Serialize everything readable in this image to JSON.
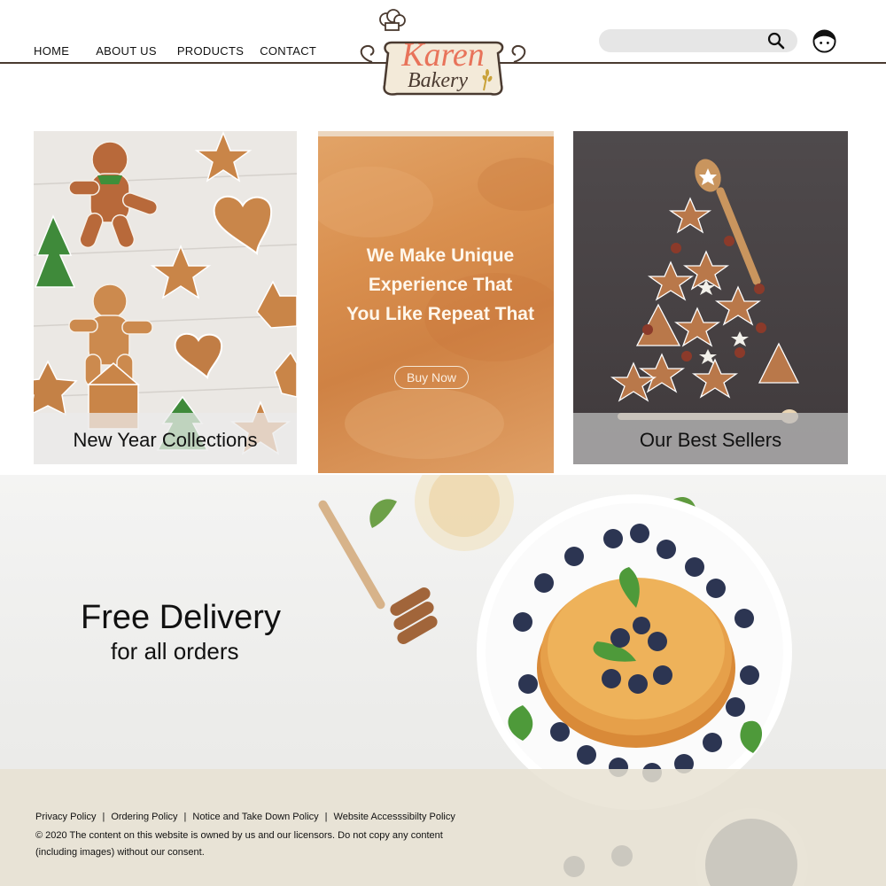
{
  "nav": {
    "home": "HOME",
    "about": "ABOUT US",
    "products": "PRODUCTS",
    "contact": "CONTACT"
  },
  "logo": {
    "line1": "Karen",
    "line2": "Bakery"
  },
  "search": {
    "placeholder": ""
  },
  "cards": {
    "left_caption": "New Year Collections",
    "center_promo": "We Make Unique Experience That You Like Repeat That",
    "center_line1": "We Make Unique",
    "center_line2": "Experience That",
    "center_line3": "You Like Repeat That",
    "center_button": "Buy Now",
    "right_caption": "Our Best Sellers"
  },
  "hero": {
    "title": "Free Delivery",
    "subtitle": "for all orders"
  },
  "footer": {
    "links": [
      "Privacy  Policy",
      "Ordering Policy",
      "Notice and Take Down Policy",
      "Website Accesssibilty  Policy"
    ],
    "copyright_line1": "© 2020 The content on this website is owned by us and our licensors. Do not copy any content",
    "copyright_line2": "(including images) without our consent."
  },
  "colors": {
    "accent": "#e8735a",
    "brand_brown": "#4a3a30",
    "footer_bg": "#e8e2d2"
  },
  "icons": {
    "search": "search-icon",
    "avatar": "user-avatar-icon",
    "chef_hat": "chef-hat-icon"
  }
}
